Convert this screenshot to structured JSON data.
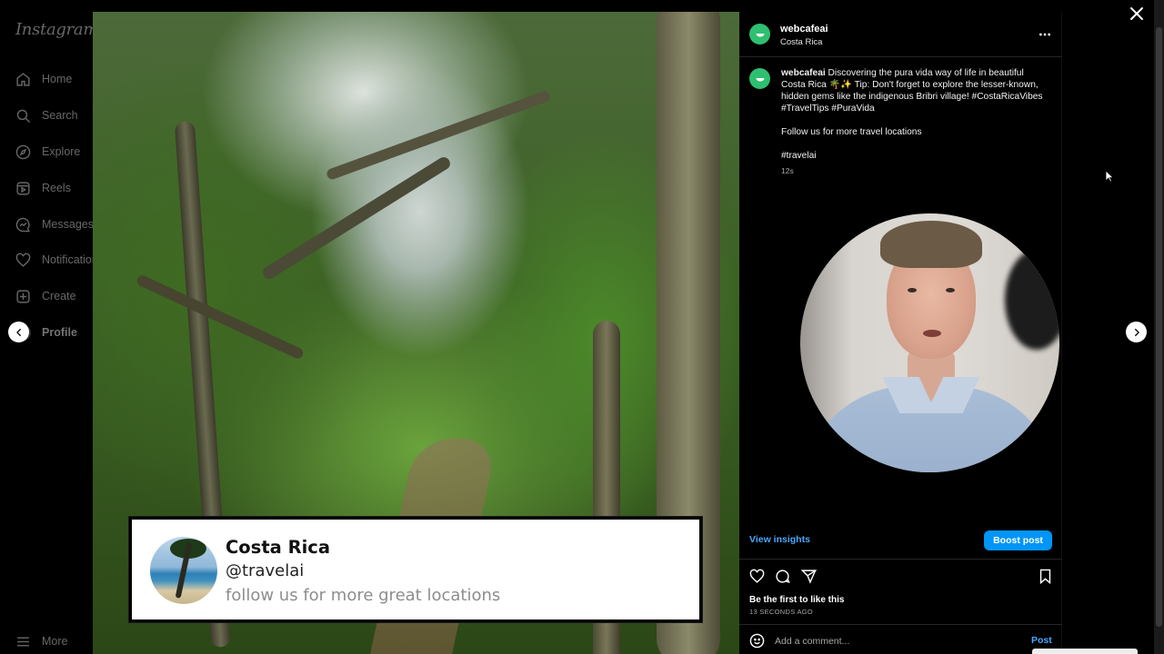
{
  "sidebar": {
    "logo": "Instagram",
    "items": [
      {
        "label": "Home"
      },
      {
        "label": "Search"
      },
      {
        "label": "Explore"
      },
      {
        "label": "Reels"
      },
      {
        "label": "Messages"
      },
      {
        "label": "Notifications"
      },
      {
        "label": "Create"
      },
      {
        "label": "Profile"
      }
    ],
    "more_label": "More"
  },
  "overlay_card": {
    "title": "Costa Rica",
    "handle": "@travelai",
    "tagline": "follow us for more great locations"
  },
  "post": {
    "username": "webcafeai",
    "location": "Costa Rica",
    "caption": {
      "username": "webcafeai",
      "text": " Discovering the pura vida way of life in beautiful Costa Rica 🌴✨ Tip: Don't forget to explore the lesser-known, hidden gems like the indigenous Bribri village! #CostaRicaVibes #TravelTips #PuraVida",
      "follow": "Follow us for more travel locations",
      "tag": "#travelai",
      "time": "12s"
    },
    "view_insights": "View insights",
    "boost_label": "Boost post",
    "likes_text": "Be the first to like this",
    "posted_ago": "13 SECONDS AGO",
    "comment_placeholder": "Add a comment...",
    "post_label": "Post"
  },
  "colors": {
    "accent_blue": "#0095f6",
    "link_blue": "#4aa8ff",
    "avatar_green": "#2fbf71"
  },
  "icons": [
    "home-icon",
    "search-icon",
    "explore-icon",
    "reels-icon",
    "messages-icon",
    "heart-icon",
    "create-icon",
    "menu-icon",
    "more-dots-icon",
    "like-icon",
    "comment-icon",
    "share-icon",
    "bookmark-icon",
    "emoji-icon",
    "close-icon",
    "chevron-left-icon",
    "chevron-right-icon"
  ]
}
